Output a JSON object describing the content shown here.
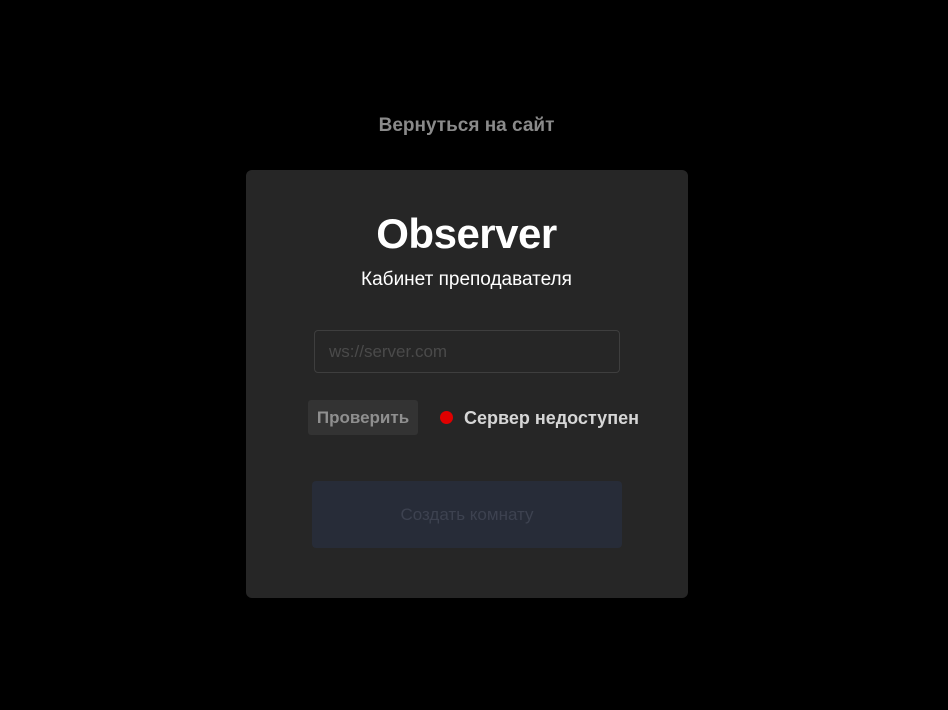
{
  "header": {
    "back_link_label": "Вернуться на сайт"
  },
  "card": {
    "logo": "Observer",
    "subtitle": "Кабинет преподавателя",
    "server_input": {
      "value": "",
      "placeholder": "ws://server.com"
    },
    "check_button_label": "Проверить",
    "status": {
      "text": "Сервер недоступен",
      "color": "#e00000"
    },
    "create_button_label": "Создать комнату"
  },
  "colors": {
    "background": "#000000",
    "card": "#262626",
    "create_button_bg": "#272c38"
  }
}
